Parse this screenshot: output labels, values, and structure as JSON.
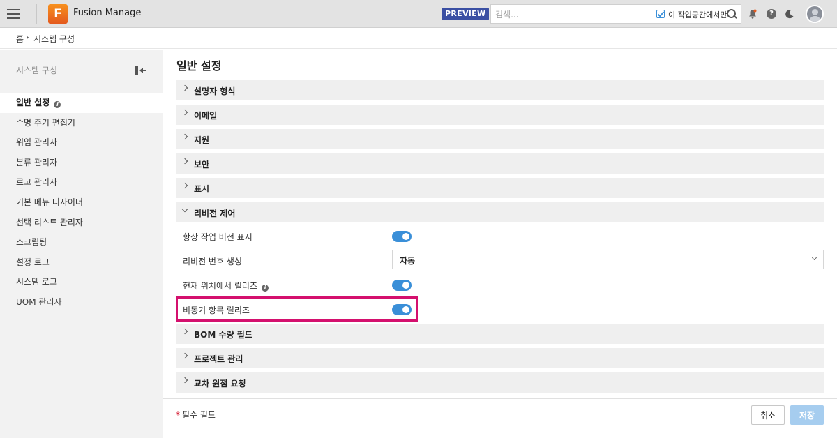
{
  "app": {
    "title": "Fusion Manage",
    "logo_letter": "F",
    "preview_badge": "PREVIEW",
    "accent_color": "#3a8fd8",
    "logo_color": "#f7901e"
  },
  "search": {
    "placeholder": "검색...",
    "workspace_only_label": "이 작업공간에서만",
    "workspace_only_checked": true
  },
  "header_icons": [
    "menu-icon",
    "bell-icon",
    "help-icon",
    "moon-icon",
    "avatar"
  ],
  "breadcrumb": {
    "home": "홈",
    "separator": "›",
    "current": "시스템 구성"
  },
  "sidebar": {
    "title": "시스템 구성",
    "items": [
      {
        "label": "일반 설정",
        "active": true,
        "info": true
      },
      {
        "label": "수명 주기 편집기"
      },
      {
        "label": "위임 관리자"
      },
      {
        "label": "분류 관리자"
      },
      {
        "label": "로고 관리자"
      },
      {
        "label": "기본 메뉴 디자이너"
      },
      {
        "label": "선택 리스트 관리자"
      },
      {
        "label": "스크립팅"
      },
      {
        "label": "설정 로그"
      },
      {
        "label": "시스템 로그"
      },
      {
        "label": "UOM 관리자"
      }
    ]
  },
  "main": {
    "title": "일반 설정",
    "sections": [
      {
        "label": "설명자 형식",
        "expanded": false
      },
      {
        "label": "이메일",
        "expanded": false
      },
      {
        "label": "지원",
        "expanded": false
      },
      {
        "label": "보안",
        "expanded": false
      },
      {
        "label": "표시",
        "expanded": false
      },
      {
        "label": "리비전 제어",
        "expanded": true
      },
      {
        "label": "BOM 수량 필드",
        "expanded": false
      },
      {
        "label": "프로젝트 관리",
        "expanded": false
      },
      {
        "label": "교차 원점 요청",
        "expanded": false
      }
    ],
    "revision_settings": [
      {
        "label": "항상 작업 버전 표시",
        "type": "toggle",
        "value": true
      },
      {
        "label": "리비전 번호 생성",
        "type": "select",
        "value": "자동"
      },
      {
        "label": "현재 위치에서 릴리즈",
        "type": "toggle",
        "value": true,
        "info": true
      },
      {
        "label": "비동기 항목 릴리즈",
        "type": "toggle",
        "value": true,
        "highlighted": true
      }
    ],
    "highlight_color": "#d4106e"
  },
  "footer": {
    "required_star": "*",
    "required_label": "필수 필드",
    "cancel_label": "취소",
    "save_label": "저장"
  }
}
